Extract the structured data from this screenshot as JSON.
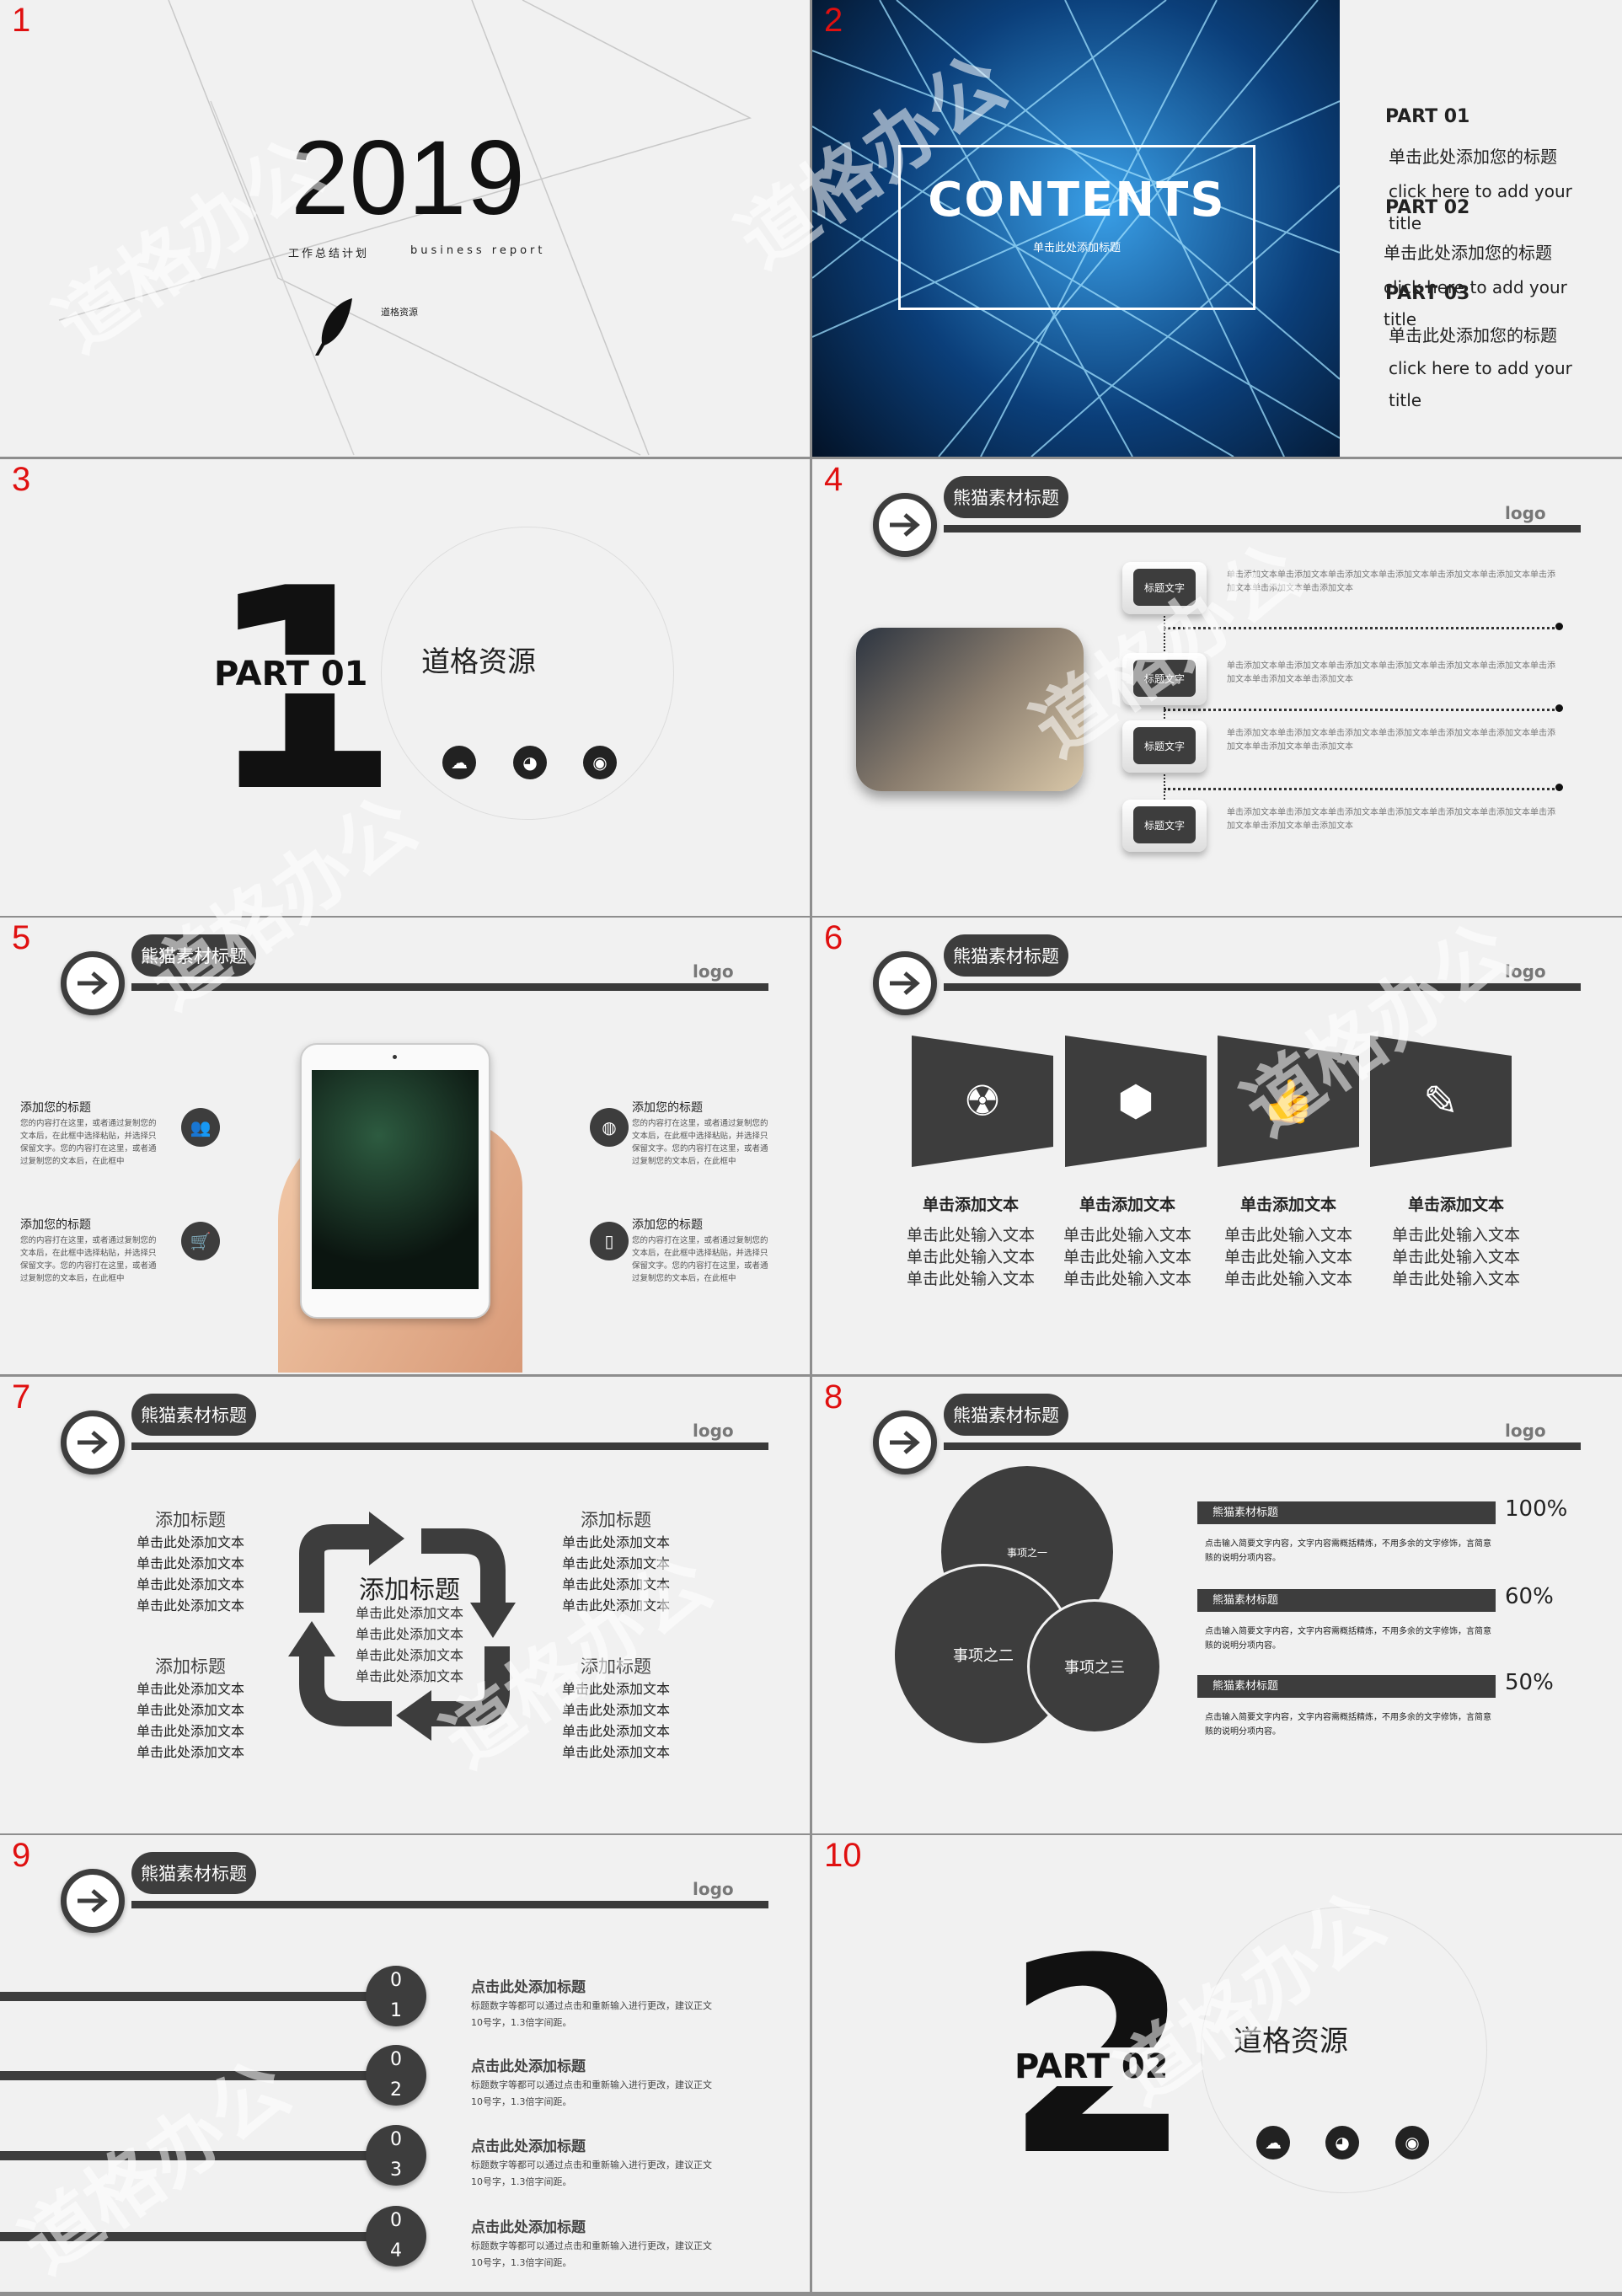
{
  "slide_numbers": [
    "1",
    "2",
    "3",
    "4",
    "5",
    "6",
    "7",
    "8",
    "9",
    "10"
  ],
  "watermark": "道格办公",
  "colors": {
    "slide_bg": "#f1f1f1",
    "dark": "#3d3d3d",
    "number_red": "#e01010"
  },
  "slide1": {
    "year": "2019",
    "subtitle_cn": "工作总结计划",
    "subtitle_en": "business report",
    "brand": "道格资源"
  },
  "slide2": {
    "heading": "CONTENTS",
    "subheading": "单击此处添加标题",
    "parts": [
      {
        "label": "PART 01",
        "cn": "单击此处添加您的标题",
        "en": "click here to add your title"
      },
      {
        "label": "PART 02",
        "cn": "单击此处添加您的标题",
        "en": "click here to add your title"
      },
      {
        "label": "PART 03",
        "cn": "单击此处添加您的标题",
        "en": "click here to add your title"
      }
    ]
  },
  "slide3": {
    "number": "1",
    "part": "PART 01",
    "brand": "道格资源",
    "icons": [
      "cloud-icon",
      "wechat-icon",
      "weibo-icon"
    ]
  },
  "header": {
    "title": "熊猫素材标题",
    "logo": "logo"
  },
  "slide4": {
    "items": [
      {
        "label": "标题文字",
        "text": "单击添加文本单击添加文本单击添加文本单击添加文本单击添加文本单击添加文本单击添加文本单击添加文本单击添加文本"
      },
      {
        "label": "标题文字",
        "text": "单击添加文本单击添加文本单击添加文本单击添加文本单击添加文本单击添加文本单击添加文本单击添加文本单击添加文本"
      },
      {
        "label": "标题文字",
        "text": "单击添加文本单击添加文本单击添加文本单击添加文本单击添加文本单击添加文本单击添加文本单击添加文本单击添加文本"
      },
      {
        "label": "标题文字",
        "text": "单击添加文本单击添加文本单击添加文本单击添加文本单击添加文本单击添加文本单击添加文本单击添加文本单击添加文本"
      }
    ]
  },
  "slide5": {
    "items": [
      {
        "title": "添加您的标题",
        "text": "您的内容打在这里，或者通过复制您的文本后，在此框中选择粘贴，并选择只保留文字。您的内容打在这里，或者通过复制您的文本后，在此框中",
        "icon": "users-icon"
      },
      {
        "title": "添加您的标题",
        "text": "您的内容打在这里，或者通过复制您的文本后，在此框中选择粘贴，并选择只保留文字。您的内容打在这里，或者通过复制您的文本后，在此框中",
        "icon": "cart-icon"
      },
      {
        "title": "添加您的标题",
        "text": "您的内容打在这里，或者通过复制您的文本后，在此框中选择粘贴，并选择只保留文字。您的内容打在这里，或者通过复制您的文本后，在此框中",
        "icon": "globe-icon"
      },
      {
        "title": "添加您的标题",
        "text": "您的内容打在这里，或者通过复制您的文本后，在此框中选择粘贴，并选择只保留文字。您的内容打在这里，或者通过复制您的文本后，在此框中",
        "icon": "phone-icon"
      }
    ]
  },
  "slide6": {
    "columns": [
      {
        "title": "单击添加文本",
        "lines": [
          "单击此处输入文本",
          "单击此处输入文本",
          "单击此处输入文本"
        ],
        "icon": "radiation-icon"
      },
      {
        "title": "单击添加文本",
        "lines": [
          "单击此处输入文本",
          "单击此处输入文本",
          "单击此处输入文本"
        ],
        "icon": "cube-icon"
      },
      {
        "title": "单击添加文本",
        "lines": [
          "单击此处输入文本",
          "单击此处输入文本",
          "单击此处输入文本"
        ],
        "icon": "thumbs-up-icon"
      },
      {
        "title": "单击添加文本",
        "lines": [
          "单击此处输入文本",
          "单击此处输入文本",
          "单击此处输入文本"
        ],
        "icon": "pencil-icon"
      }
    ]
  },
  "slide7": {
    "center_title": "添加标题",
    "center_lines": [
      "单击此处添加文本",
      "单击此处添加文本",
      "单击此处添加文本",
      "单击此处添加文本"
    ],
    "blocks": [
      {
        "title": "添加标题",
        "lines": [
          "单击此处添加文本",
          "单击此处添加文本",
          "单击此处添加文本",
          "单击此处添加文本"
        ]
      },
      {
        "title": "添加标题",
        "lines": [
          "单击此处添加文本",
          "单击此处添加文本",
          "单击此处添加文本",
          "单击此处添加文本"
        ]
      },
      {
        "title": "添加标题",
        "lines": [
          "单击此处添加文本",
          "单击此处添加文本",
          "单击此处添加文本",
          "单击此处添加文本"
        ]
      },
      {
        "title": "添加标题",
        "lines": [
          "单击此处添加文本",
          "单击此处添加文本",
          "单击此处添加文本",
          "单击此处添加文本"
        ]
      }
    ]
  },
  "slide8": {
    "circles": [
      "事项之一",
      "事项之二",
      "事项之三"
    ],
    "bars": [
      {
        "title": "熊猫素材标题",
        "percent": 100,
        "label": "100%",
        "text": "点击输入简要文字内容，文字内容需概括精炼，不用多余的文字修饰，言简意赅的说明分项内容。"
      },
      {
        "title": "熊猫素材标题",
        "percent": 60,
        "label": "60%",
        "text": "点击输入简要文字内容，文字内容需概括精炼，不用多余的文字修饰，言简意赅的说明分项内容。"
      },
      {
        "title": "熊猫素材标题",
        "percent": 50,
        "label": "50%",
        "text": "点击输入简要文字内容，文字内容需概括精炼，不用多余的文字修饰，言简意赅的说明分项内容。"
      }
    ]
  },
  "slide9": {
    "items": [
      {
        "n1": "0",
        "n2": "1",
        "title": "点击此处添加标题",
        "text": "标题数字等都可以通过点击和重新输入进行更改，建议正文10号字，1.3倍字间距。"
      },
      {
        "n1": "0",
        "n2": "2",
        "title": "点击此处添加标题",
        "text": "标题数字等都可以通过点击和重新输入进行更改，建议正文10号字，1.3倍字间距。"
      },
      {
        "n1": "0",
        "n2": "3",
        "title": "点击此处添加标题",
        "text": "标题数字等都可以通过点击和重新输入进行更改，建议正文10号字，1.3倍字间距。"
      },
      {
        "n1": "0",
        "n2": "4",
        "title": "点击此处添加标题",
        "text": "标题数字等都可以通过点击和重新输入进行更改，建议正文10号字，1.3倍字间距。"
      }
    ]
  },
  "slide10": {
    "number": "2",
    "part": "PART 02",
    "brand": "道格资源",
    "icons": [
      "cloud-icon",
      "wechat-icon",
      "weibo-icon"
    ]
  }
}
